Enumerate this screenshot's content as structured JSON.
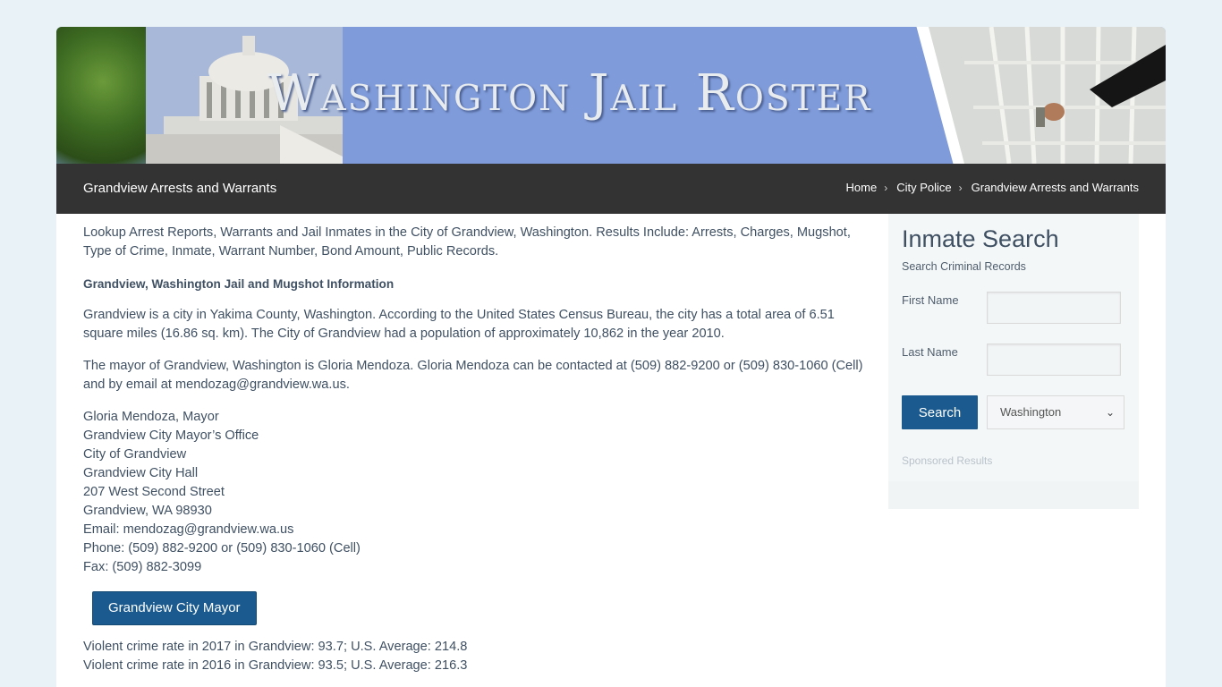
{
  "banner": {
    "title": "Washington Jail Roster"
  },
  "navbar": {
    "page_title": "Grandview Arrests and Warrants",
    "breadcrumb": [
      {
        "label": "Home"
      },
      {
        "label": "City Police"
      },
      {
        "label": "Grandview Arrests and Warrants"
      }
    ]
  },
  "main": {
    "intro": "Lookup Arrest Reports, Warrants and Jail Inmates in the City of Grandview, Washington. Results Include: Arrests, Charges, Mugshot, Type of Crime, Inmate, Warrant Number, Bond Amount, Public Records.",
    "heading": "Grandview, Washington Jail and Mugshot Information",
    "para1": "Grandview is a city in Yakima County, Washington. According to the United States Census Bureau, the city has a total area of 6.51 square miles (16.86 sq. km). The City of Grandview had a population of approximately 10,862 in the year 2010.",
    "para2": "The mayor of Grandview, Washington is Gloria Mendoza. Gloria Mendoza can be contacted at (509) 882-9200 or (509) 830-1060 (Cell) and by email at mendozag@grandview.wa.us.",
    "address": [
      "Gloria Mendoza, Mayor",
      "Grandview City Mayor’s Office",
      "City of Grandview",
      "Grandview City Hall",
      "207 West Second Street",
      "Grandview, WA 98930",
      "Email: mendozag@grandview.wa.us",
      "Phone: (509) 882-9200 or (509) 830-1060 (Cell)",
      "Fax: (509) 882-3099"
    ],
    "mayor_button": "Grandview City Mayor",
    "stats": [
      "Violent crime rate in 2017 in Grandview: 93.7; U.S. Average: 214.8",
      "Violent crime rate in 2016 in Grandview: 93.5; U.S. Average: 216.3"
    ]
  },
  "sidebar": {
    "title": "Inmate Search",
    "subtitle": "Search Criminal Records",
    "first_name_label": "First Name",
    "first_name_value": "",
    "last_name_label": "Last Name",
    "last_name_value": "",
    "search_button": "Search",
    "state_selected": "Washington",
    "sponsored": "Sponsored Results"
  },
  "colors": {
    "page_bg": "#e8f2f7",
    "navbar": "#333333",
    "accent_button": "#1a5a8e",
    "banner_blue": "#7f9bd9",
    "text": "#3f5063"
  }
}
